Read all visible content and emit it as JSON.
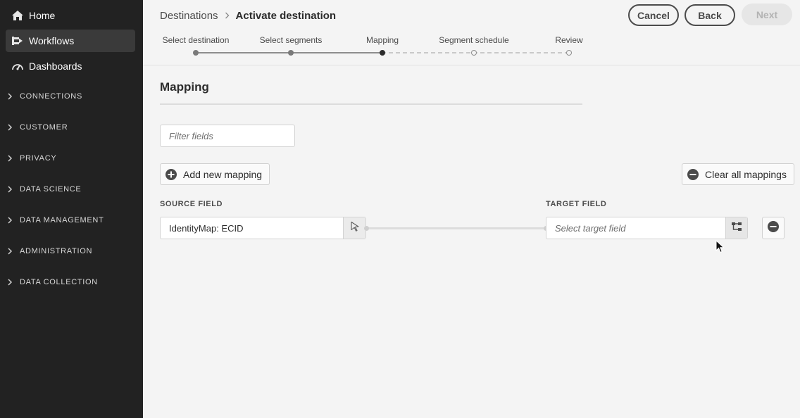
{
  "sidebar": {
    "top_items": [
      {
        "label": "Home",
        "icon": "home-icon",
        "active": false
      },
      {
        "label": "Workflows",
        "icon": "workflow-icon",
        "active": true
      },
      {
        "label": "Dashboards",
        "icon": "dashboard-icon",
        "active": false
      }
    ],
    "groups": [
      {
        "label": "CONNECTIONS"
      },
      {
        "label": "CUSTOMER"
      },
      {
        "label": "PRIVACY"
      },
      {
        "label": "DATA SCIENCE"
      },
      {
        "label": "DATA MANAGEMENT"
      },
      {
        "label": "ADMINISTRATION"
      },
      {
        "label": "DATA COLLECTION"
      }
    ]
  },
  "header": {
    "breadcrumb_parent": "Destinations",
    "breadcrumb_current": "Activate destination",
    "cancel_label": "Cancel",
    "back_label": "Back",
    "next_label": "Next"
  },
  "steps": [
    {
      "label": "Select destination",
      "state": "done"
    },
    {
      "label": "Select segments",
      "state": "done"
    },
    {
      "label": "Mapping",
      "state": "current"
    },
    {
      "label": "Segment schedule",
      "state": "future"
    },
    {
      "label": "Review",
      "state": "future"
    }
  ],
  "main": {
    "title": "Mapping",
    "filter_placeholder": "Filter fields",
    "add_mapping_label": "Add new mapping",
    "clear_mappings_label": "Clear all mappings",
    "source_header": "SOURCE FIELD",
    "target_header": "TARGET FIELD",
    "mapping": {
      "source_value": "IdentityMap: ECID",
      "target_placeholder": "Select target field"
    }
  },
  "colors": {
    "sidebar_bg": "#222222",
    "sidebar_active": "#3a3a3a",
    "page_bg": "#f4f4f4"
  }
}
